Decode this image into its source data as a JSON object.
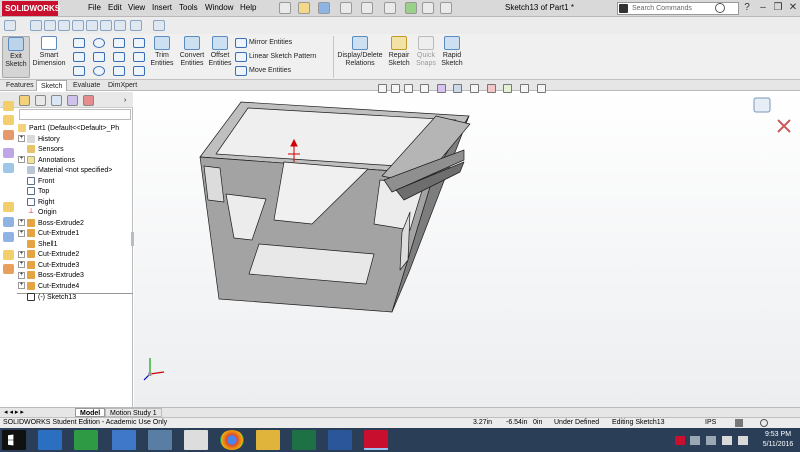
{
  "app": {
    "logo": "SOLIDWORKS",
    "window_title": "Sketch13 of Part1 *",
    "menus": [
      "File",
      "Edit",
      "View",
      "Insert",
      "Tools",
      "Window",
      "Help"
    ],
    "search_placeholder": "Search Commands"
  },
  "commands": {
    "exit_sketch": "Exit Sketch",
    "smart_dimension": "Smart Dimension",
    "trim_entities": "Trim Entities",
    "convert_entities": "Convert Entities",
    "offset_entities": "Offset Entities",
    "mirror_entities": "Mirror Entities",
    "linear_sketch_pattern": "Linear Sketch Pattern",
    "move_entities": "Move Entities",
    "display_delete_relations": "Display/Delete Relations",
    "repair_sketch": "Repair Sketch",
    "quick_snaps": "Quick Snaps",
    "rapid_sketch": "Rapid Sketch"
  },
  "tabs": [
    "Features",
    "Sketch",
    "Evaluate",
    "DimXpert"
  ],
  "active_tab": "Sketch",
  "tree": {
    "root": "Part1  (Default<<Default>_Ph",
    "items": [
      "History",
      "Sensors",
      "Annotations",
      "Material <not specified>",
      "Front",
      "Top",
      "Right",
      "Origin",
      "Boss-Extrude2",
      "Cut-Extrude1",
      "Shell1",
      "Cut-Extrude2",
      "Cut-Extrude3",
      "Boss-Extrude3",
      "Cut-Extrude4",
      "(-) Sketch13"
    ]
  },
  "bottom_tabs": [
    "Model",
    "Motion Study 1"
  ],
  "status": {
    "edition": "SOLIDWORKS Student Edition - Academic Use Only",
    "x": "3.27in",
    "y": "-6.54in",
    "z": "0in",
    "state": "Under Defined",
    "editing": "Editing Sketch13",
    "units": "IPS"
  },
  "clock": {
    "time": "9:53 PM",
    "date": "5/11/2016"
  },
  "colors": {
    "solidworks_red": "#c8102e",
    "model_gray": "#a9a9a9",
    "taskbar": "#2a3f57"
  }
}
